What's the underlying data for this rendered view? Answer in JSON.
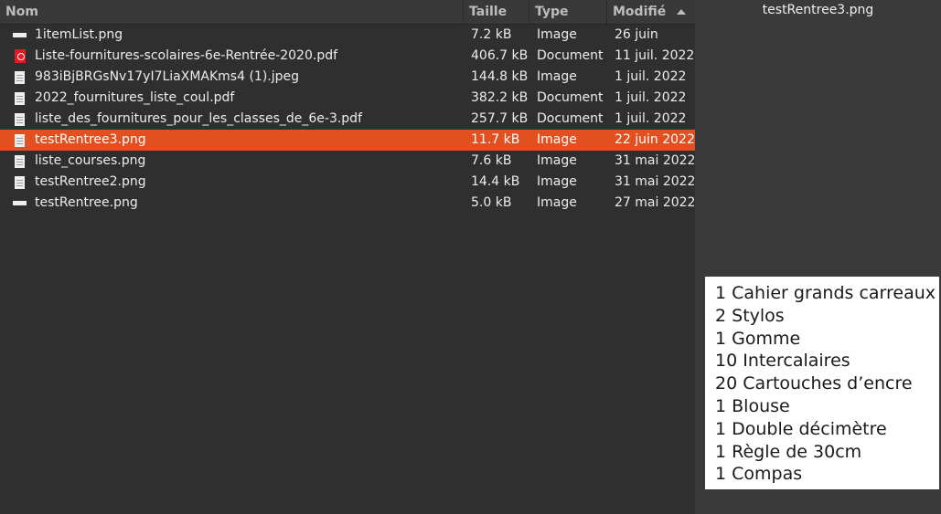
{
  "columns": {
    "name": "Nom",
    "size": "Taille",
    "type": "Type",
    "modified": "Modifié"
  },
  "files": [
    {
      "name": "1itemList.png",
      "size": "7.2 kB",
      "type": "Image",
      "modified": "26 juin",
      "icon": "image-wide-icon",
      "selected": false
    },
    {
      "name": "Liste-fournitures-scolaires-6e-Rentrée-2020.pdf",
      "size": "406.7 kB",
      "type": "Document",
      "modified": "11 juil. 2022",
      "icon": "pdf-icon",
      "selected": false
    },
    {
      "name": "983iBjBRGsNv17yI7LiaXMAKms4 (1).jpeg",
      "size": "144.8 kB",
      "type": "Image",
      "modified": "1 juil. 2022",
      "icon": "image-icon",
      "selected": false
    },
    {
      "name": "2022_fournitures_liste_coul.pdf",
      "size": "382.2 kB",
      "type": "Document",
      "modified": "1 juil. 2022",
      "icon": "document-icon",
      "selected": false
    },
    {
      "name": "liste_des_fournitures_pour_les_classes_de_6e-3.pdf",
      "size": "257.7 kB",
      "type": "Document",
      "modified": "1 juil. 2022",
      "icon": "document-icon",
      "selected": false
    },
    {
      "name": "testRentree3.png",
      "size": "11.7 kB",
      "type": "Image",
      "modified": "22 juin 2022",
      "icon": "image-icon",
      "selected": true
    },
    {
      "name": "liste_courses.png",
      "size": "7.6 kB",
      "type": "Image",
      "modified": "31 mai 2022",
      "icon": "image-icon",
      "selected": false
    },
    {
      "name": "testRentree2.png",
      "size": "14.4 kB",
      "type": "Image",
      "modified": "31 mai 2022",
      "icon": "image-icon",
      "selected": false
    },
    {
      "name": "testRentree.png",
      "size": "5.0 kB",
      "type": "Image",
      "modified": "27 mai 2022",
      "icon": "image-wide-icon",
      "selected": false
    }
  ],
  "preview": {
    "title": "testRentree3.png",
    "lines": [
      "1 Cahier grands carreaux",
      "2 Stylos",
      "1 Gomme",
      "10 Intercalaires",
      "20 Cartouches d’encre",
      "1 Blouse",
      "1 Double décimètre",
      "1 Règle de 30cm",
      "1 Compas"
    ]
  },
  "colors": {
    "selection": "#e1501e",
    "pane_bg": "#2f2f2f",
    "header_bg": "#393939"
  }
}
